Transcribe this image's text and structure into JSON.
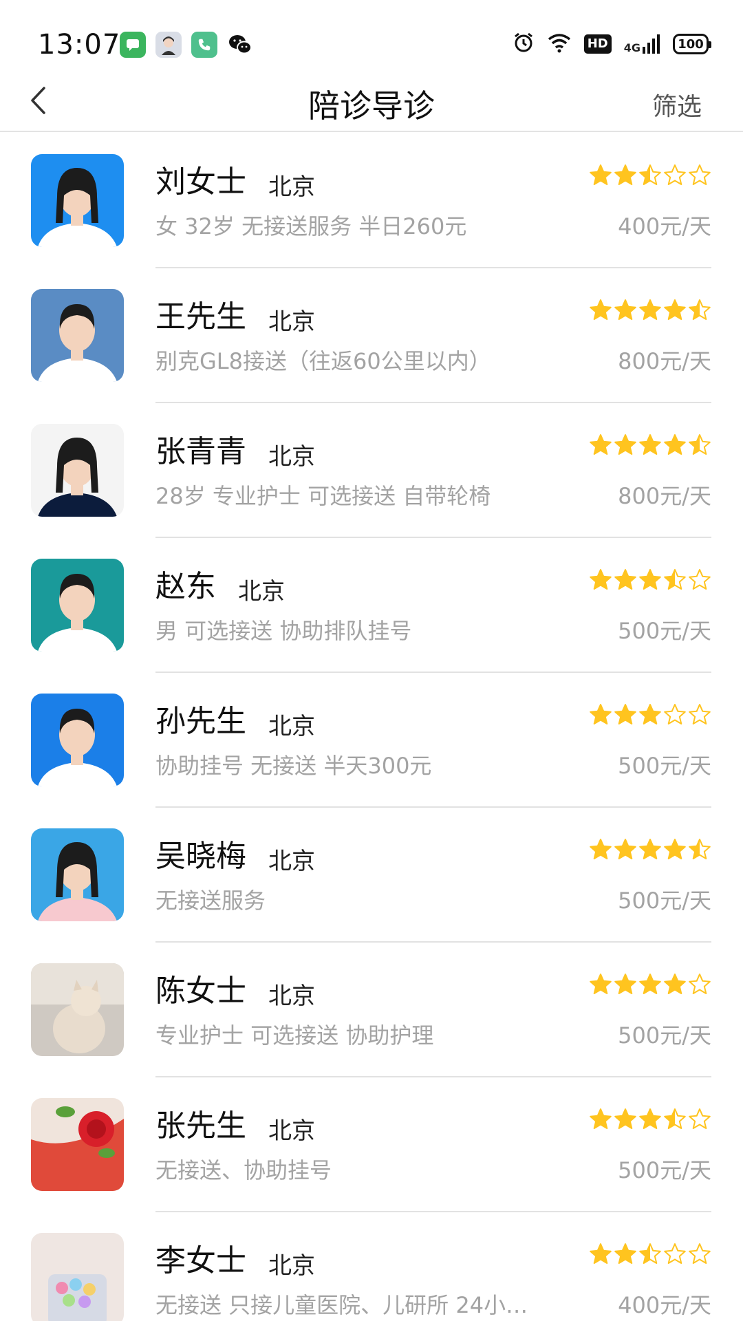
{
  "status_bar": {
    "time": "13:07",
    "app_icons": [
      "message-icon",
      "avatar-icon",
      "phone-icon",
      "wechat-icon"
    ],
    "system_icons": [
      "alarm-icon",
      "wifi-icon",
      "hd-icon",
      "signal-4g-icon",
      "battery-icon"
    ],
    "hd_label": "HD",
    "network_label": "4G",
    "battery_label": "100"
  },
  "nav": {
    "title": "陪诊导诊",
    "filter_label": "筛选",
    "back_icon": "chevron-left-icon"
  },
  "colors": {
    "star_filled": "#FFC41F",
    "star_empty_stroke": "#FFC41F",
    "text_primary": "#111111",
    "text_secondary": "#A3A3A3",
    "divider": "#E2E2E2"
  },
  "escorts": [
    {
      "name": "刘女士",
      "city": "北京",
      "description": "女  32岁  无接送服务  半日260元",
      "price": "400元/天",
      "rating": 2.5,
      "avatar_bg": "#1e8ef0"
    },
    {
      "name": "王先生",
      "city": "北京",
      "description": "别克GL8接送（往返60公里以内）",
      "price": "800元/天",
      "rating": 4.5,
      "avatar_bg": "#5a8cc4"
    },
    {
      "name": "张青青",
      "city": "北京",
      "description": "28岁  专业护士  可选接送  自带轮椅",
      "price": "800元/天",
      "rating": 4.5,
      "avatar_bg": "#f4f4f4"
    },
    {
      "name": "赵东",
      "city": "北京",
      "description": "男  可选接送  协助排队挂号",
      "price": "500元/天",
      "rating": 3.5,
      "avatar_bg": "#1a9a9a"
    },
    {
      "name": "孙先生",
      "city": "北京",
      "description": "协助挂号  无接送  半天300元",
      "price": "500元/天",
      "rating": 3,
      "avatar_bg": "#1b7fe8"
    },
    {
      "name": "吴晓梅",
      "city": "北京",
      "description": "无接送服务",
      "price": "500元/天",
      "rating": 4.5,
      "avatar_bg": "#3aa6e6"
    },
    {
      "name": "陈女士",
      "city": "北京",
      "description": "专业护士  可选接送  协助护理",
      "price": "500元/天",
      "rating": 4,
      "avatar_bg": "#cfc9c2"
    },
    {
      "name": "张先生",
      "city": "北京",
      "description": "无接送、协助挂号",
      "price": "500元/天",
      "rating": 3.5,
      "avatar_bg": "#e04a3a"
    },
    {
      "name": "李女士",
      "city": "北京",
      "description": "无接送  只接儿童医院、儿研所  24小…",
      "price": "400元/天",
      "rating": 2.5,
      "avatar_bg": "#efe6e2"
    }
  ]
}
